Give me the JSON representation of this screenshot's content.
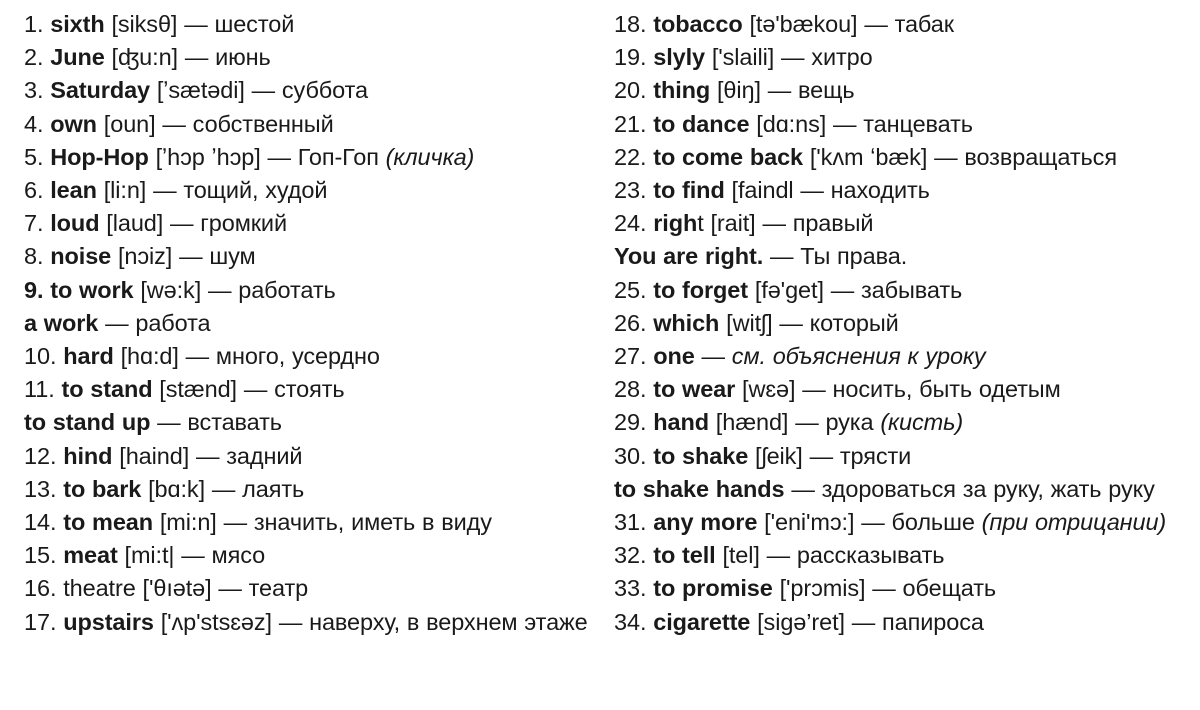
{
  "document": {
    "type": "vocabulary-list",
    "title": "English-Russian vocabulary list",
    "background_color": "#ffffff",
    "text_color": "#1a1a1a",
    "columns": 2,
    "total_numbered_entries": 34
  },
  "left_column": {
    "entries": [
      {
        "num": "1.",
        "term": "sixth",
        "ipa": "[siksθ]",
        "dash": "—",
        "gloss": "шестой",
        "gloss_italic": ""
      },
      {
        "num": "2.",
        "term": "June",
        "ipa": "[ʤu:n]",
        "dash": "—",
        "gloss": "июнь",
        "gloss_italic": ""
      },
      {
        "num": "3.",
        "term": "Saturday",
        "ipa": "[ʼsætədi]",
        "dash": "—",
        "gloss": "суббота",
        "gloss_italic": ""
      },
      {
        "num": "4.",
        "term": "own",
        "ipa": "[oun]",
        "dash": "—",
        "gloss": "собственный",
        "gloss_italic": ""
      },
      {
        "num": "5.",
        "term": "Hop-Hop",
        "ipa": "[ʼhɔp ʼhɔp]",
        "dash": "—",
        "gloss": "Гоп-Гоп",
        "gloss_italic": "(кличка)"
      },
      {
        "num": "6.",
        "term": "lean",
        "ipa": "[li:n]",
        "dash": "—",
        "gloss": "тощий, худой",
        "gloss_italic": ""
      },
      {
        "num": "7.",
        "term": "loud",
        "ipa": "[laud]",
        "dash": "—",
        "gloss": "громкий",
        "gloss_italic": ""
      },
      {
        "num": "8.",
        "term": "noise",
        "ipa": "[nɔiz]",
        "dash": "—",
        "gloss": "шум",
        "gloss_italic": ""
      },
      {
        "num": "9.",
        "term": "to work",
        "ipa": "[wə:k]",
        "dash": "—",
        "gloss": "работать",
        "gloss_italic": ""
      },
      {
        "num": "",
        "term": "a work",
        "ipa": "",
        "dash": "—",
        "gloss": "работа",
        "gloss_italic": ""
      },
      {
        "num": "10.",
        "term": "hard",
        "ipa": "[hɑ:d]",
        "dash": "—",
        "gloss": "много, усердно",
        "gloss_italic": ""
      },
      {
        "num": "11.",
        "term": "to stand",
        "ipa": "[stænd]",
        "dash": "—",
        "gloss": "стоять",
        "gloss_italic": ""
      },
      {
        "num": "",
        "term": "to stand up",
        "ipa": "",
        "dash": "—",
        "gloss": "вставать",
        "gloss_italic": ""
      },
      {
        "num": "12.",
        "term": "hind",
        "ipa": "[haind]",
        "dash": "—",
        "gloss": "задний",
        "gloss_italic": ""
      },
      {
        "num": "13.",
        "term": "to bark",
        "ipa": "[bɑ:k]",
        "dash": "—",
        "gloss": "лаять",
        "gloss_italic": ""
      },
      {
        "num": "14.",
        "term": "to mean",
        "ipa": "[mi:n]",
        "dash": "—",
        "gloss": "значить, иметь в виду",
        "gloss_italic": ""
      },
      {
        "num": "15.",
        "term": "meat",
        "ipa": "[mi:t|",
        "dash": "—",
        "gloss": "мясо",
        "gloss_italic": ""
      },
      {
        "num": "16.",
        "term": "theatre",
        "ipa": "['θıətə]",
        "dash": "—",
        "gloss": "театр",
        "gloss_italic": ""
      },
      {
        "num": "17.",
        "term": "upstairs",
        "ipa": "['ʌp'stsɛəz]",
        "dash": "—",
        "gloss": "наверху, в верхнем этаже",
        "gloss_italic": ""
      }
    ]
  },
  "right_column": {
    "entries": [
      {
        "num": "18.",
        "term": "tobacco",
        "ipa": "[tə'bækou]",
        "dash": "—",
        "gloss": "табак",
        "gloss_italic": ""
      },
      {
        "num": "19.",
        "term": "slyly",
        "ipa": "['slaili]",
        "dash": "—",
        "gloss": "хитро",
        "gloss_italic": ""
      },
      {
        "num": "20.",
        "term": "thing",
        "ipa": "[θiŋ]",
        "dash": "—",
        "gloss": "вещь",
        "gloss_italic": ""
      },
      {
        "num": "21.",
        "term": "to dance",
        "ipa": "[dɑ:ns]",
        "dash": "—",
        "gloss": "танцевать",
        "gloss_italic": ""
      },
      {
        "num": "22.",
        "term": "to come back",
        "ipa": "['kʌm ʻbæk]",
        "dash": "—",
        "gloss": "возвращаться",
        "gloss_italic": ""
      },
      {
        "num": "23.",
        "term": "to find",
        "ipa": "[faindl",
        "dash": "—",
        "gloss": "находить",
        "gloss_italic": ""
      },
      {
        "num": "24.",
        "term": "righ",
        "term_tail": "t",
        "ipa": "[rait]",
        "dash": "—",
        "gloss": "правый",
        "gloss_italic": ""
      },
      {
        "num": "",
        "term": "You are right.",
        "ipa": "",
        "dash": "—",
        "gloss": "Ты права.",
        "gloss_italic": ""
      },
      {
        "num": "25.",
        "term": "to forget",
        "ipa": "[fə'get]",
        "dash": "—",
        "gloss": "забывать",
        "gloss_italic": ""
      },
      {
        "num": "26.",
        "term": "which",
        "ipa": "[witʃ]",
        "dash": "—",
        "gloss": "который",
        "gloss_italic": ""
      },
      {
        "num": "27.",
        "term": "one",
        "ipa": "",
        "dash": "—",
        "gloss": "",
        "gloss_italic": "см. объяснения к уроку"
      },
      {
        "num": "28.",
        "term": "to wear",
        "ipa": "[wɛə]",
        "dash": "—",
        "gloss": "носить, быть одетым",
        "gloss_italic": ""
      },
      {
        "num": "29.",
        "term": "hand",
        "ipa": "[hænd]",
        "dash": "—",
        "gloss": "рука",
        "gloss_italic": "(кисть)"
      },
      {
        "num": "30.",
        "term": "to shake",
        "ipa": "[ʃeik]",
        "dash": "—",
        "gloss": "трясти",
        "gloss_italic": ""
      },
      {
        "num": "",
        "term": "to shake hands",
        "ipa": "",
        "dash": "—",
        "gloss": "здороваться за руку, жать руку",
        "gloss_italic": ""
      },
      {
        "num": "31.",
        "term": "any more",
        "ipa": "['eni'mɔ:]",
        "dash": "—",
        "gloss": "больше",
        "gloss_italic": "(при отрицании)"
      },
      {
        "num": "32.",
        "term": "to tell",
        "ipa": "[tel]",
        "dash": "—",
        "gloss": "рассказывать",
        "gloss_italic": ""
      },
      {
        "num": "33.",
        "term": "to promise",
        "ipa": "['prɔmis]",
        "dash": "—",
        "gloss": "обещать",
        "gloss_italic": ""
      },
      {
        "num": "34.",
        "term": "cigarette",
        "ipa": "[sigə’ret]",
        "dash": "—",
        "gloss": "папироса",
        "gloss_italic": ""
      }
    ]
  }
}
